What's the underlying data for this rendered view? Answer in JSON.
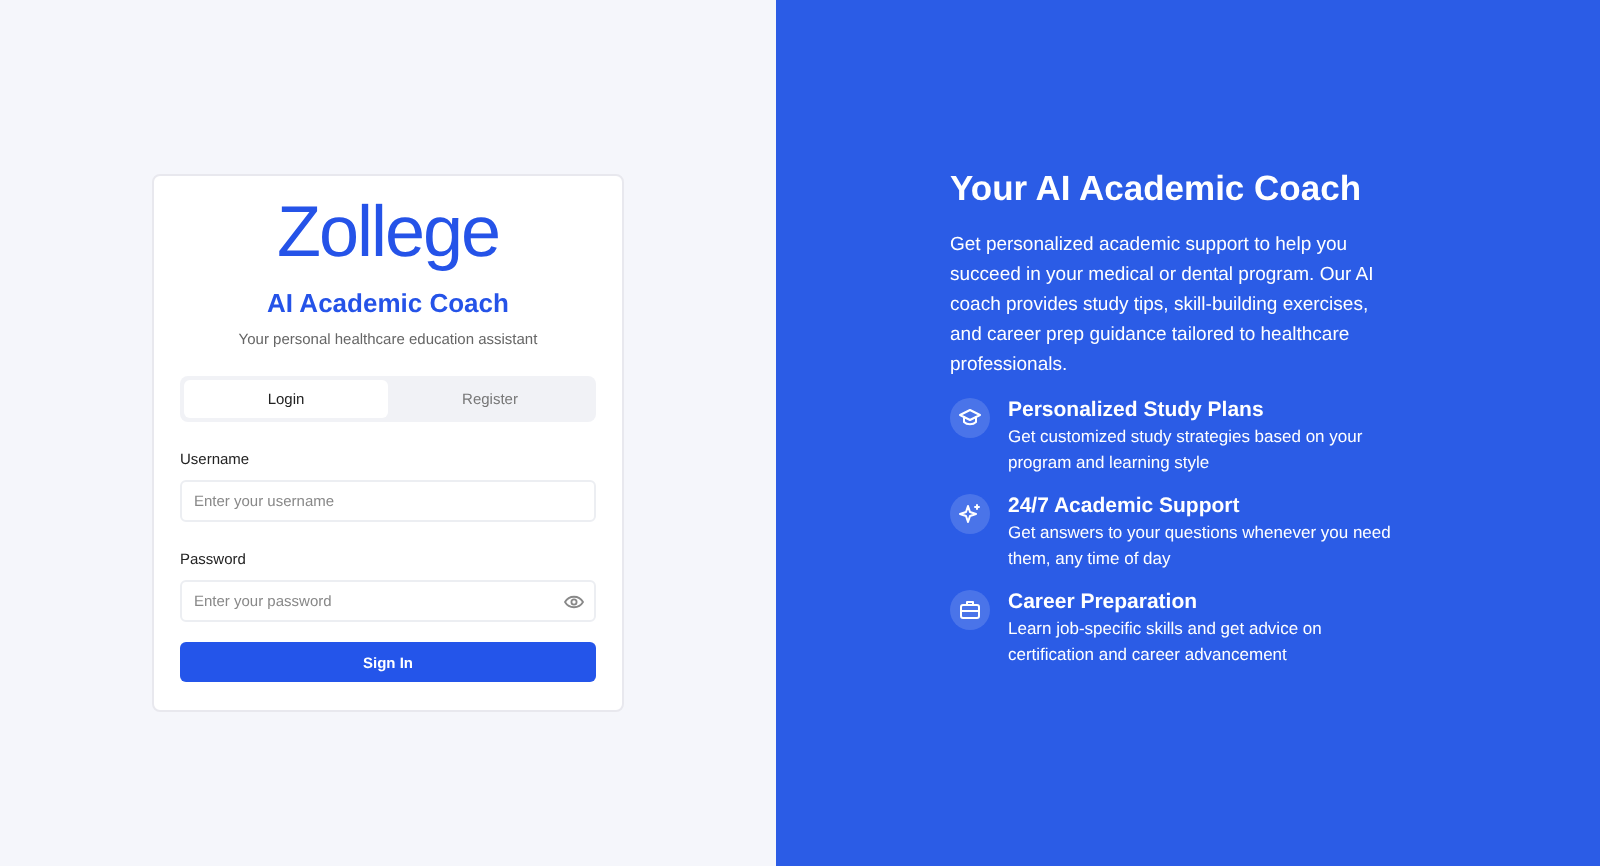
{
  "logo": "Zollege",
  "title": "AI Academic Coach",
  "subtitle": "Your personal healthcare education assistant",
  "tabs": [
    {
      "label": "Login",
      "selected": true
    },
    {
      "label": "Register",
      "selected": false
    }
  ],
  "fields": [
    {
      "label": "Username",
      "placeholder": "Enter your username",
      "password": false
    },
    {
      "label": "Password",
      "placeholder": "Enter your password",
      "password": true
    }
  ],
  "submit": "Sign In",
  "hero": {
    "title": "Your AI Academic Coach",
    "text": "Get personalized academic support to help you succeed in your medical or dental program. Our AI coach provides study tips, skill-building exercises, and career prep guidance tailored to healthcare professionals.",
    "features": [
      {
        "title": "Personalized Study Plans",
        "text": "Get customized study strategies based on your program and learning style"
      },
      {
        "title": "24/7 Academic Support",
        "text": "Get answers to your questions whenever you need them, any time of day"
      },
      {
        "title": "Career Preparation",
        "text": "Learn job-specific skills and get advice on certification and career advancement"
      }
    ]
  }
}
